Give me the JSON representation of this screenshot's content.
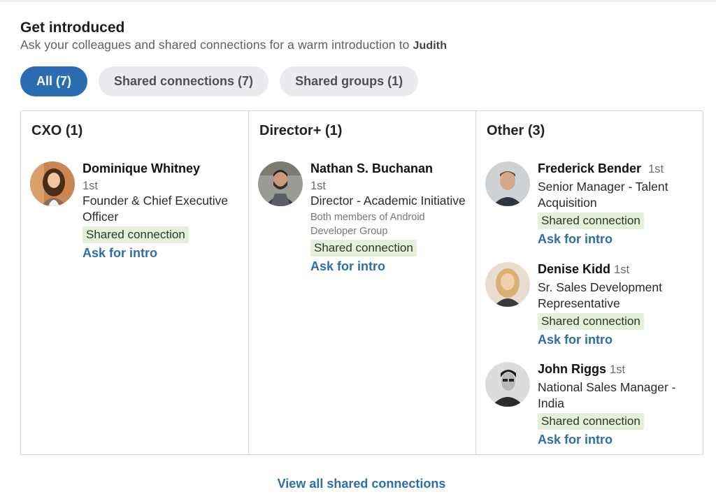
{
  "header": {
    "title": "Get introduced",
    "subtitle_prefix": "Ask your colleagues and shared connections for a warm introduction to ",
    "subtitle_name": "Judith"
  },
  "tabs": [
    {
      "label": "All (7)",
      "active": true
    },
    {
      "label": "Shared connections (7)",
      "active": false
    },
    {
      "label": "Shared groups (1)",
      "active": false
    }
  ],
  "columns": [
    {
      "title": "CXO (1)",
      "people": [
        {
          "name": "Dominique Whitney",
          "degree": "1st",
          "role": "Founder & Chief Executive Officer",
          "badge": "Shared connection",
          "action": "Ask for intro"
        }
      ]
    },
    {
      "title": "Director+ (1)",
      "people": [
        {
          "name": "Nathan S. Buchanan",
          "degree": "1st",
          "role": "Director - Academic Initiative",
          "note": "Both members of Android Developer Group",
          "badge": "Shared connection",
          "action": "Ask for intro"
        }
      ]
    },
    {
      "title": "Other (3)",
      "people": [
        {
          "name": "Frederick Bender",
          "degree": "1st",
          "role": "Senior Manager - Talent Acquisition",
          "badge": "Shared connection",
          "action": "Ask for intro"
        },
        {
          "name": "Denise Kidd",
          "degree": "1st",
          "role": "Sr. Sales Development Representative",
          "badge": "Shared connection",
          "action": "Ask for intro"
        },
        {
          "name": "John Riggs",
          "degree": "1st",
          "role": "National Sales Manager - India",
          "badge": "Shared connection",
          "action": "Ask for intro"
        }
      ]
    }
  ],
  "footer": {
    "view_all_label": "View all shared connections"
  },
  "colors": {
    "accent": "#2c6cb0",
    "link": "#2e6ea8",
    "badge_bg": "#e4f0dc",
    "tab_bg": "#e9ebee"
  }
}
